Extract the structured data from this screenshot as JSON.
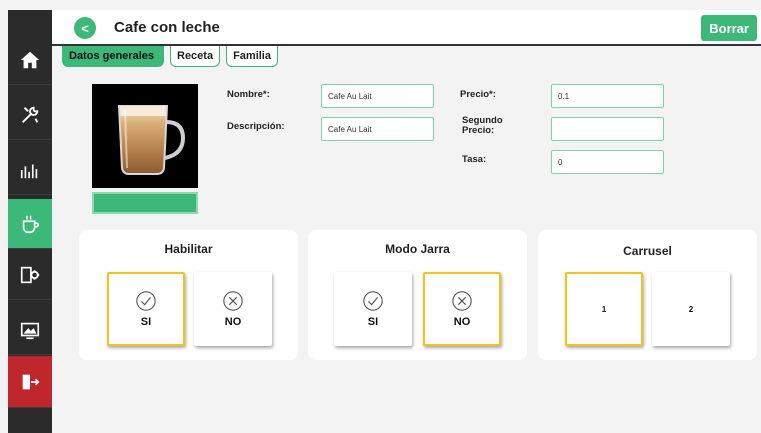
{
  "header": {
    "back_label": "<",
    "title": "Cafe con leche",
    "delete_label": "Borrar"
  },
  "tabs": [
    {
      "label": "Datos generales",
      "active": true
    },
    {
      "label": "Receta",
      "active": false
    },
    {
      "label": "Familia",
      "active": false
    }
  ],
  "sidebar": {
    "items": [
      {
        "icon": "home-icon"
      },
      {
        "icon": "tools-icon"
      },
      {
        "icon": "stats-icon"
      },
      {
        "icon": "cup-icon",
        "active": true
      },
      {
        "icon": "machine-icon"
      },
      {
        "icon": "display-icon"
      },
      {
        "icon": "exit-icon"
      }
    ]
  },
  "product": {
    "image": "coffee-latte-glass-icon"
  },
  "form": {
    "nombre_label": "Nombre*:",
    "nombre_value": "Cafe Au Lait",
    "descripcion_label": "Descripción:",
    "descripcion_value": "Cafe Au Lait",
    "precio_label": "Precio*:",
    "precio_value": "0.1",
    "segundo_precio_label_1": "Segundo",
    "segundo_precio_label_2": "Precio:",
    "segundo_precio_value": "",
    "tasa_label": "Tasa:",
    "tasa_value": "0"
  },
  "habilitar": {
    "title": "Habilitar",
    "si_label": "SI",
    "no_label": "NO",
    "selected": "SI"
  },
  "modo_jarra": {
    "title": "Modo Jarra",
    "si_label": "SI",
    "no_label": "NO",
    "selected": "NO"
  },
  "carrusel": {
    "title": "Carrusel",
    "option_1": "1",
    "option_2": "2",
    "selected": "1"
  },
  "colors": {
    "accent": "#3cb878",
    "sidebar": "#2b2b2b",
    "exit": "#c0272d",
    "selected_border": "#f2c418"
  }
}
